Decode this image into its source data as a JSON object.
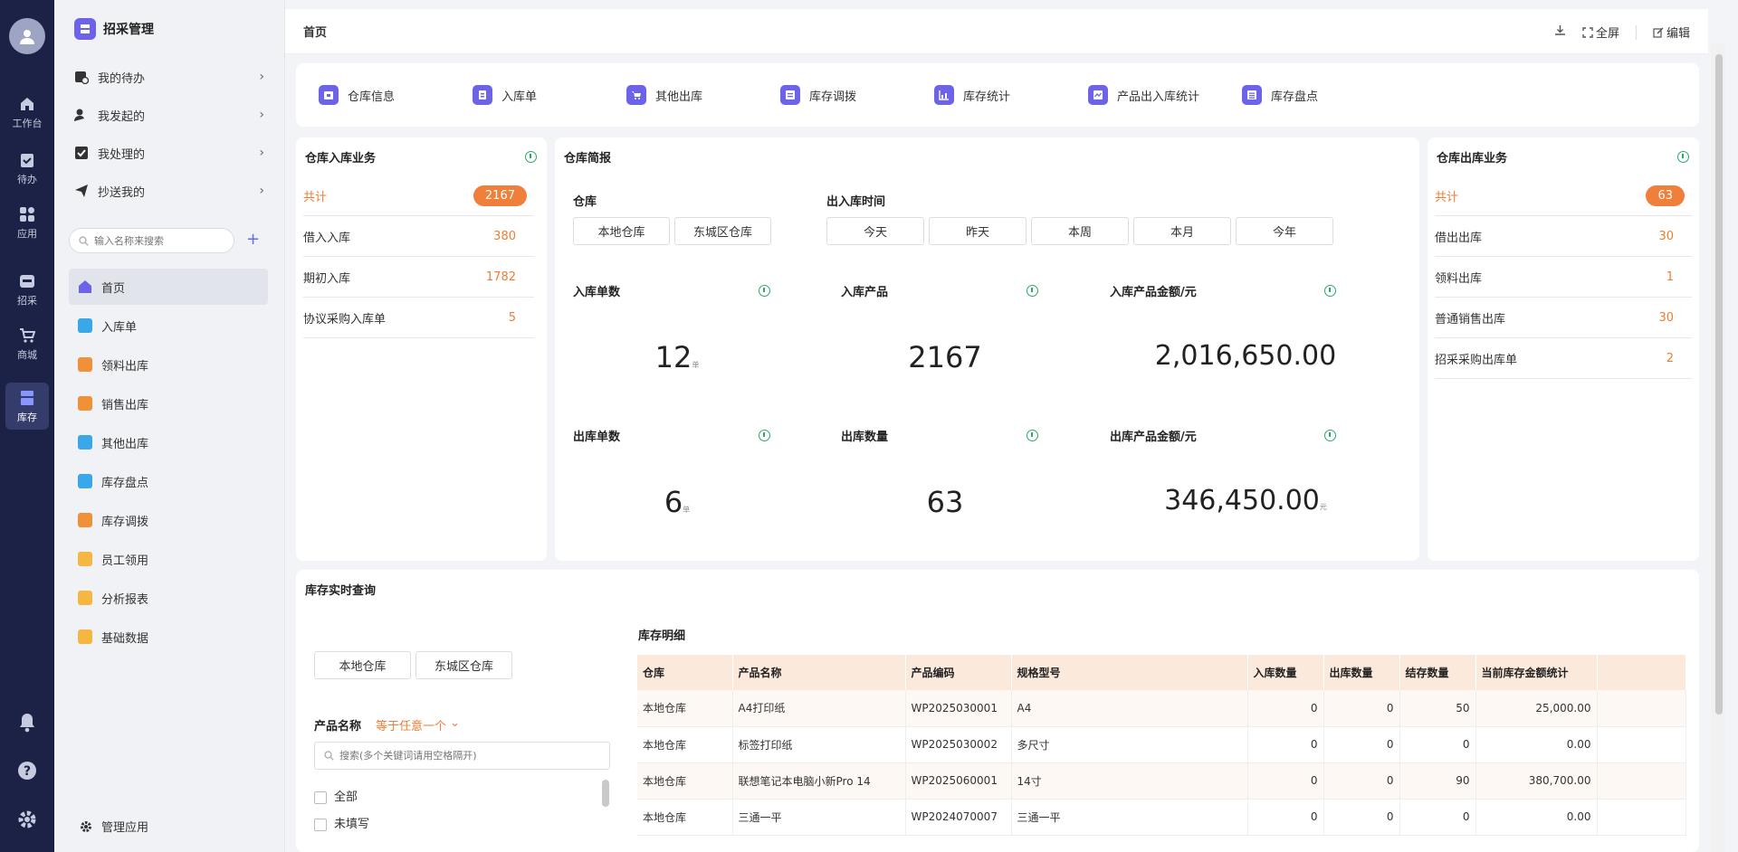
{
  "rail": {
    "items": [
      {
        "label": "工作台",
        "icon": "home-icon"
      },
      {
        "label": "待办",
        "icon": "clipboard-icon"
      },
      {
        "label": "应用",
        "icon": "apps-icon"
      },
      {
        "label": "招采",
        "icon": "procure-icon"
      },
      {
        "label": "商城",
        "icon": "cart-icon"
      },
      {
        "label": "库存",
        "icon": "warehouse-icon"
      }
    ]
  },
  "sidebar": {
    "brand": "招采管理",
    "tasks": [
      "我的待办",
      "我发起的",
      "我处理的",
      "抄送我的"
    ],
    "search_placeholder": "输入名称来搜索",
    "nav": [
      {
        "label": "首页",
        "color": "#6c63e8"
      },
      {
        "label": "入库单",
        "color": "#3aa7e8"
      },
      {
        "label": "领料出库",
        "color": "#f0913a"
      },
      {
        "label": "销售出库",
        "color": "#f0913a"
      },
      {
        "label": "其他出库",
        "color": "#3aa7e8"
      },
      {
        "label": "库存盘点",
        "color": "#3aa7e8"
      },
      {
        "label": "库存调拨",
        "color": "#f0913a"
      },
      {
        "label": "员工领用",
        "color": "#f5b642"
      },
      {
        "label": "分析报表",
        "color": "#f5b642"
      },
      {
        "label": "基础数据",
        "color": "#f5b642"
      }
    ],
    "manage": "管理应用"
  },
  "topbar": {
    "title": "首页",
    "fullscreen": "全屏",
    "edit": "编辑"
  },
  "quick": [
    "仓库信息",
    "入库单",
    "其他出库",
    "库存调拨",
    "库存统计",
    "产品出入库统计",
    "库存盘点"
  ],
  "inbound": {
    "title": "仓库入库业务",
    "total_label": "共计",
    "total": "2167",
    "rows": [
      {
        "label": "借入入库",
        "value": "380"
      },
      {
        "label": "期初入库",
        "value": "1782"
      },
      {
        "label": "协议采购入库单",
        "value": "5"
      }
    ]
  },
  "brief": {
    "title": "仓库简报",
    "warehouse_label": "仓库",
    "warehouses": [
      "本地仓库",
      "东城区仓库"
    ],
    "time_label": "出入库时间",
    "times": [
      "今天",
      "昨天",
      "本周",
      "本月",
      "今年"
    ],
    "metrics": [
      {
        "label": "入库单数",
        "value": "12",
        "unit": "单"
      },
      {
        "label": "入库产品",
        "value": "2167",
        "unit": ""
      },
      {
        "label": "入库产品金额/元",
        "value": "2,016,650.00",
        "unit": ""
      },
      {
        "label": "出库单数",
        "value": "6",
        "unit": "单"
      },
      {
        "label": "出库数量",
        "value": "63",
        "unit": ""
      },
      {
        "label": "出库产品金额/元",
        "value": "346,450.00",
        "unit": "元"
      }
    ]
  },
  "outbound": {
    "title": "仓库出库业务",
    "total_label": "共计",
    "total": "63",
    "rows": [
      {
        "label": "借出出库",
        "value": "30"
      },
      {
        "label": "领料出库",
        "value": "1"
      },
      {
        "label": "普通销售出库",
        "value": "30"
      },
      {
        "label": "招采采购出库单",
        "value": "2"
      }
    ]
  },
  "stock": {
    "title": "库存实时查询",
    "warehouses": [
      "本地仓库",
      "东城区仓库"
    ],
    "filter_label": "产品名称",
    "filter_op": "等于任意一个",
    "filter_placeholder": "搜索(多个关键词请用空格隔开)",
    "options": [
      "全部",
      "未填写"
    ],
    "detail_title": "库存明细",
    "columns": [
      "仓库",
      "产品名称",
      "产品编码",
      "规格型号",
      "入库数量",
      "出库数量",
      "结存数量",
      "当前库存金额统计"
    ],
    "rows": [
      [
        "本地仓库",
        "A4打印纸",
        "WP2025030001",
        "A4",
        "0",
        "0",
        "50",
        "25,000.00"
      ],
      [
        "本地仓库",
        "标签打印纸",
        "WP2025030002",
        "多尺寸",
        "0",
        "0",
        "0",
        "0.00"
      ],
      [
        "本地仓库",
        "联想笔记本电脑小新Pro 14",
        "WP2025060001",
        "14寸",
        "0",
        "0",
        "90",
        "380,700.00"
      ],
      [
        "本地仓库",
        "三通一平",
        "WP2024070007",
        "三通一平",
        "0",
        "0",
        "0",
        "0.00"
      ]
    ]
  }
}
